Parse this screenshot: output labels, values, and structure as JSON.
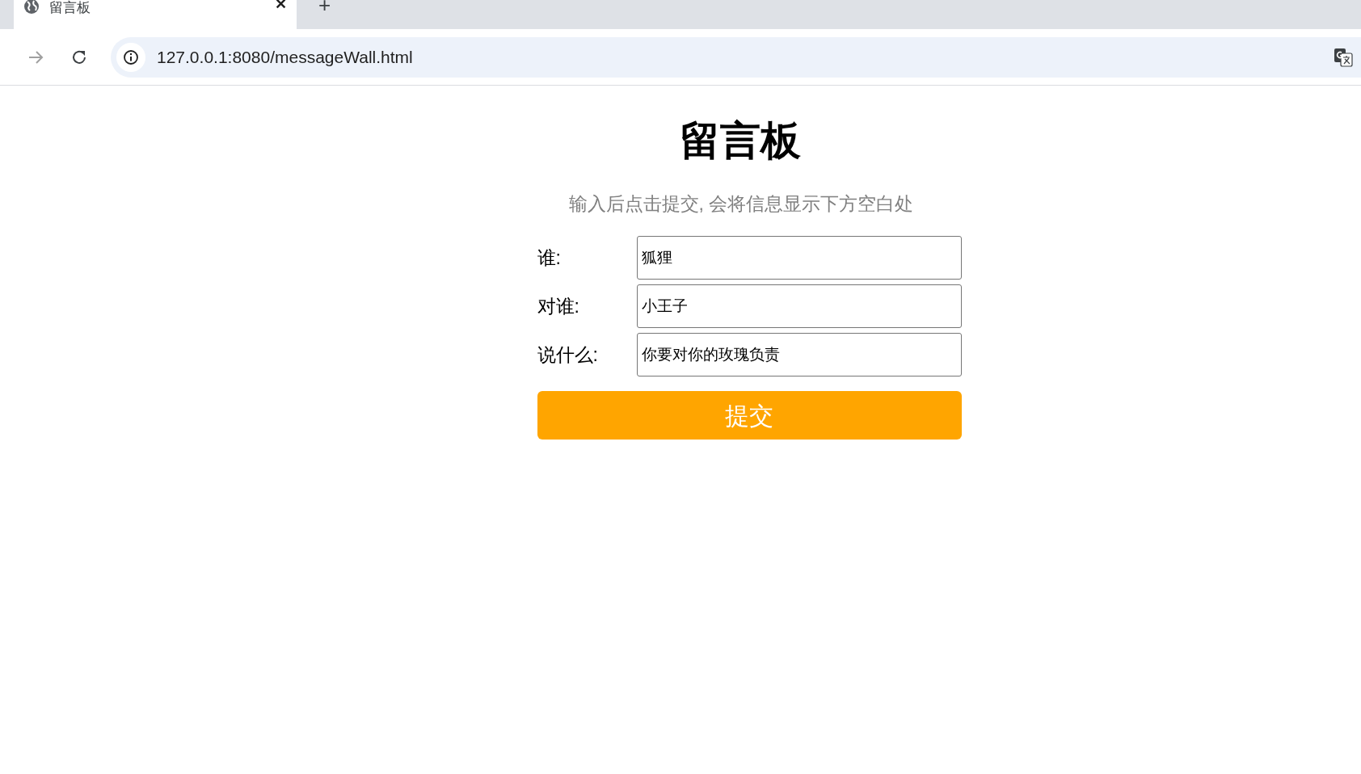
{
  "browser": {
    "tab": {
      "title": "留言板",
      "close": "✕",
      "selected": true
    },
    "new_tab": "+",
    "address": "127.0.0.1:8080/messageWall.html"
  },
  "page": {
    "title": "留言板",
    "subtitle": "输入后点击提交, 会将信息显示下方空白处",
    "fields": [
      {
        "label": "谁:",
        "value": "狐狸"
      },
      {
        "label": "对谁:",
        "value": "小王子"
      },
      {
        "label": "说什么:",
        "value": "你要对你的玫瑰负责"
      }
    ],
    "submit": "提交"
  }
}
